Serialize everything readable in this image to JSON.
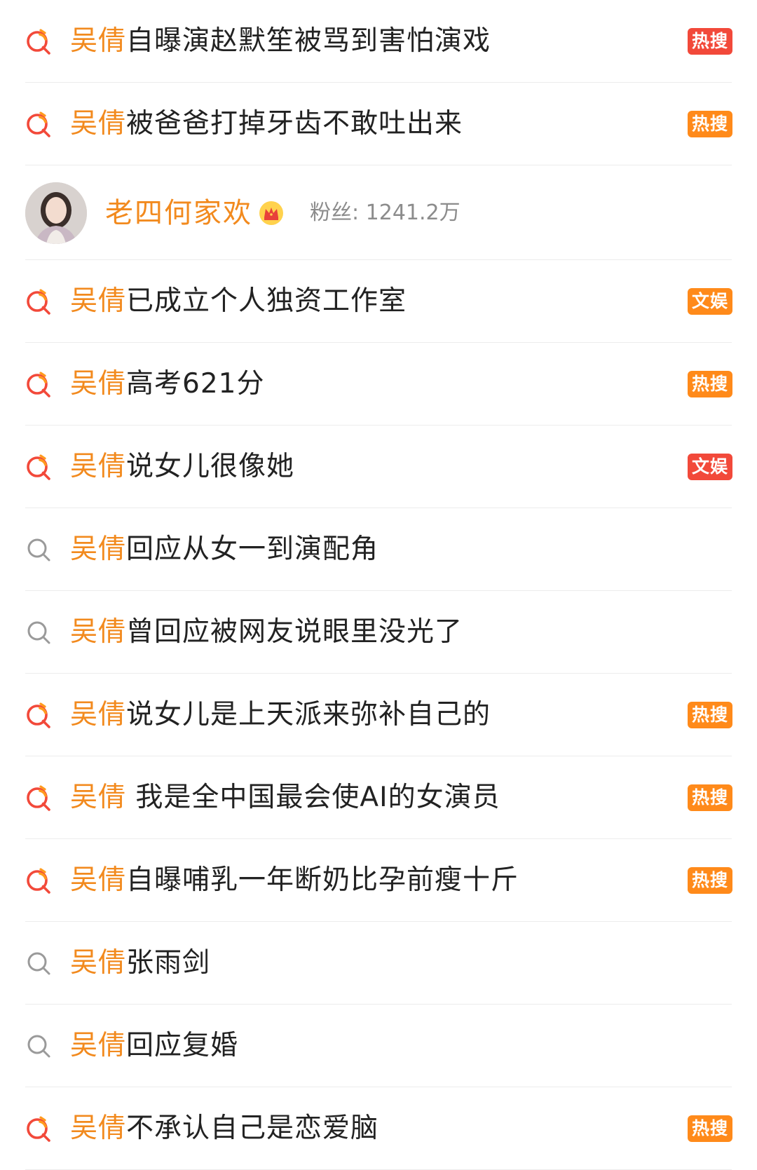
{
  "keyword": "吴倩",
  "results": [
    {
      "type": "topic",
      "hot_icon": true,
      "rest": "自曝演赵默笙被骂到害怕演戏",
      "badge": "热搜",
      "badge_style": "hot-red"
    },
    {
      "type": "topic",
      "hot_icon": true,
      "rest": "被爸爸打掉牙齿不敢吐出来",
      "badge": "热搜",
      "badge_style": "hot"
    },
    {
      "type": "user",
      "name": "老四何家欢",
      "fans_label": "粉丝: 1241.2万"
    },
    {
      "type": "topic",
      "hot_icon": true,
      "rest": "已成立个人独资工作室",
      "badge": "文娱",
      "badge_style": "ent"
    },
    {
      "type": "topic",
      "hot_icon": true,
      "rest": "高考621分",
      "badge": "热搜",
      "badge_style": "hot"
    },
    {
      "type": "topic",
      "hot_icon": true,
      "rest": "说女儿很像她",
      "badge": "文娱",
      "badge_style": "ent-red"
    },
    {
      "type": "topic",
      "hot_icon": false,
      "rest": "回应从女一到演配角",
      "badge": "",
      "badge_style": ""
    },
    {
      "type": "topic",
      "hot_icon": false,
      "rest": "曾回应被网友说眼里没光了",
      "badge": "",
      "badge_style": ""
    },
    {
      "type": "topic",
      "hot_icon": true,
      "rest": "说女儿是上天派来弥补自己的",
      "badge": "热搜",
      "badge_style": "hot"
    },
    {
      "type": "topic",
      "hot_icon": true,
      "rest": " 我是全中国最会使AI的女演员",
      "badge": "热搜",
      "badge_style": "hot"
    },
    {
      "type": "topic",
      "hot_icon": true,
      "rest": "自曝哺乳一年断奶比孕前瘦十斤",
      "badge": "热搜",
      "badge_style": "hot"
    },
    {
      "type": "topic",
      "hot_icon": false,
      "rest": "张雨剑",
      "badge": "",
      "badge_style": ""
    },
    {
      "type": "topic",
      "hot_icon": false,
      "rest": "回应复婚",
      "badge": "",
      "badge_style": ""
    },
    {
      "type": "topic",
      "hot_icon": true,
      "rest": "不承认自己是恋爱脑",
      "badge": "热搜",
      "badge_style": "hot"
    }
  ],
  "colors": {
    "keyword": "#f28a1e",
    "badge_orange": "#ff8a1a",
    "badge_red": "#f2493a",
    "hot_icon_red": "#f2493a",
    "hot_icon_orange": "#ff9a1e",
    "plain_icon_gray": "#9a9a9a"
  }
}
